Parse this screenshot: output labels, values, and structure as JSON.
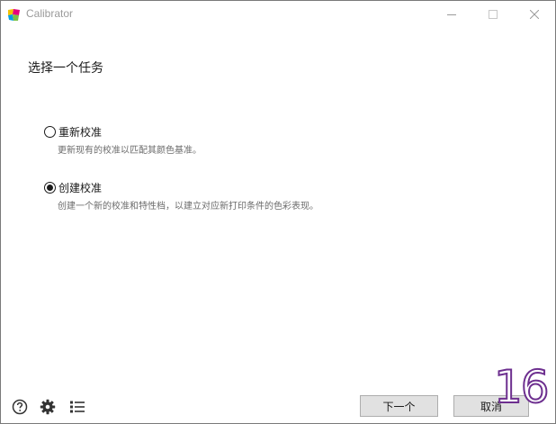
{
  "window": {
    "title": "Calibrator"
  },
  "main": {
    "heading": "选择一个任务",
    "options": [
      {
        "label": "重新校准",
        "description": "更新现有的校准以匹配其颜色基准。",
        "selected": false
      },
      {
        "label": "创建校准",
        "description": "创建一个新的校准和特性档，以建立对应新打印条件的色彩表现。",
        "selected": true
      }
    ]
  },
  "footer": {
    "next_label": "下一个",
    "cancel_label": "取消",
    "step_number": "16"
  },
  "icons": {
    "help": "help-icon",
    "settings": "gear-icon",
    "list": "list-icon"
  },
  "colors": {
    "button_bg": "#e1e1e1",
    "badge_outline": "#6d2f8f"
  }
}
